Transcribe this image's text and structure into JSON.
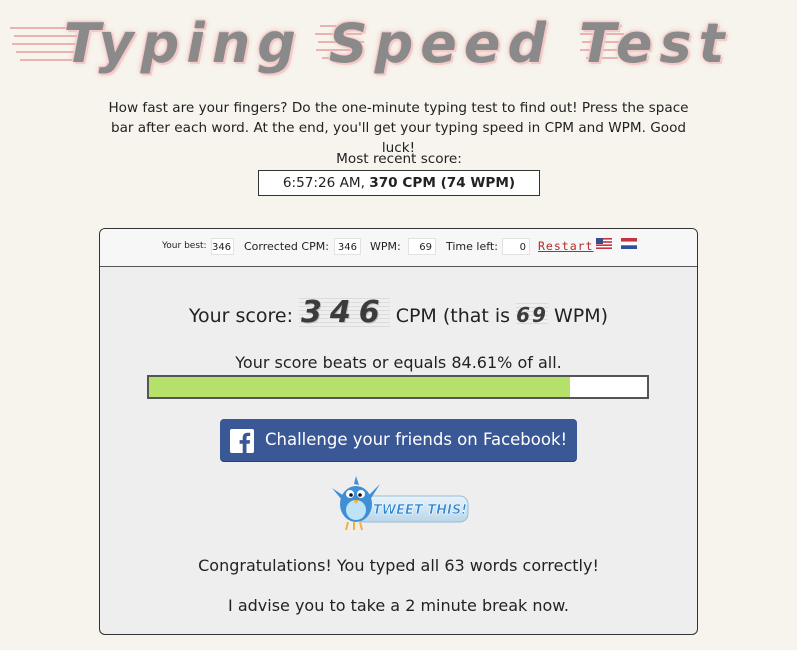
{
  "header": {
    "title": "Typing Speed Test"
  },
  "intro": {
    "text": "How fast are your fingers? Do the one-minute typing test to find out! Press the space bar after each word. At the end, you'll get your typing speed in CPM and WPM. Good luck!"
  },
  "recent": {
    "label": "Most recent score:",
    "time": "6:57:26 AM,",
    "score": "370 CPM (74 WPM)"
  },
  "toolbar": {
    "best_label": "Your best:",
    "best_value": "346",
    "corrected_label": "Corrected CPM:",
    "corrected_value": "346",
    "wpm_label": "WPM:",
    "wpm_value": "69",
    "time_label": "Time left:",
    "time_value": "0",
    "restart_label": "Restart",
    "flags": [
      "us-flag-icon",
      "nl-flag-icon"
    ]
  },
  "score": {
    "prefix": "Your score:",
    "cpm": "346",
    "middle": "CPM (that is",
    "wpm": "69",
    "suffix": "WPM)"
  },
  "beats": {
    "text": "Your score beats or equals 84.61% of all.",
    "percent": 84.61
  },
  "facebook": {
    "label": "Challenge your friends on Facebook!",
    "icon": "facebook-icon"
  },
  "tweet": {
    "label": "TWEET THIS!",
    "icon": "twitter-bird-icon"
  },
  "messages": {
    "congrats": "Congratulations! You typed all 63 words correctly!",
    "advise": "I advise you to take a 2 minute break now."
  },
  "colors": {
    "background": "#f6f4ec",
    "bar_fill": "#b5e06a",
    "facebook_blue": "#3b5896",
    "restart_red": "#b22b2b"
  }
}
